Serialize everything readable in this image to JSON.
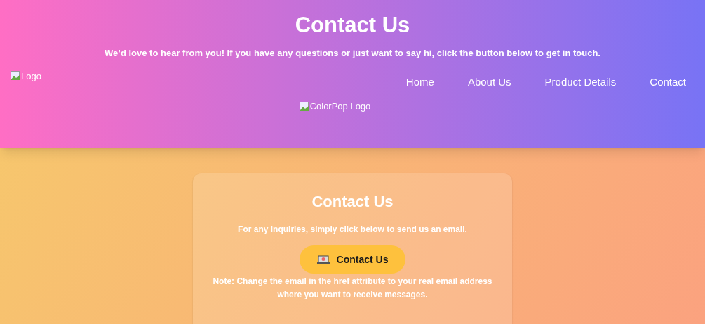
{
  "header": {
    "title": "Contact Us",
    "subtitle": "We’d love to hear from you! If you have any questions or just want to say hi, click the button below to get in touch.",
    "logo_alt": "Logo",
    "nav": [
      "Home",
      "About Us",
      "Product Details",
      "Contact"
    ],
    "brand_logo_alt": "ColorPop Logo"
  },
  "card": {
    "title": "Contact Us",
    "text": "For any inquiries, simply click below to send us an email.",
    "button": "Contact Us",
    "note": "Note: Change the email in the href attribute to your real email address where you want to receive messages."
  }
}
